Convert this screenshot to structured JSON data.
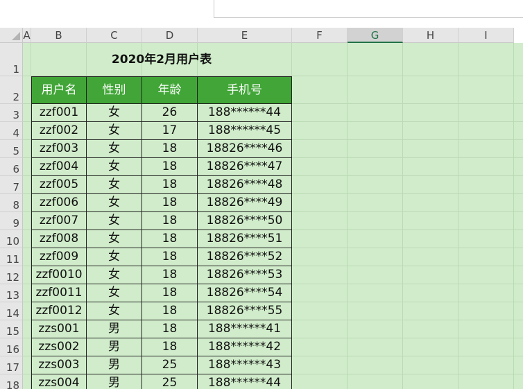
{
  "columns": [
    "A",
    "B",
    "C",
    "D",
    "E",
    "F",
    "G",
    "H",
    "I"
  ],
  "rows": [
    "1",
    "2",
    "3",
    "4",
    "5",
    "6",
    "7",
    "8",
    "9",
    "10",
    "11",
    "12",
    "13",
    "14",
    "15",
    "16",
    "17",
    "18"
  ],
  "sheet": {
    "title": "2020年2月用户表",
    "headers": [
      "用户名",
      "性别",
      "年龄",
      "手机号"
    ],
    "records": [
      [
        "zzf001",
        "女",
        "26",
        "188******44"
      ],
      [
        "zzf002",
        "女",
        "17",
        "188******45"
      ],
      [
        "zzf003",
        "女",
        "18",
        "18826****46"
      ],
      [
        "zzf004",
        "女",
        "18",
        "18826****47"
      ],
      [
        "zzf005",
        "女",
        "18",
        "18826****48"
      ],
      [
        "zzf006",
        "女",
        "18",
        "18826****49"
      ],
      [
        "zzf007",
        "女",
        "18",
        "18826****50"
      ],
      [
        "zzf008",
        "女",
        "18",
        "18826****51"
      ],
      [
        "zzf009",
        "女",
        "18",
        "18826****52"
      ],
      [
        "zzf0010",
        "女",
        "18",
        "18826****53"
      ],
      [
        "zzf0011",
        "女",
        "18",
        "18826****54"
      ],
      [
        "zzf0012",
        "女",
        "18",
        "18826****55"
      ],
      [
        "zzs001",
        "男",
        "18",
        "188******41"
      ],
      [
        "zzs002",
        "男",
        "18",
        "188******42"
      ],
      [
        "zzs003",
        "男",
        "25",
        "188******43"
      ],
      [
        "zzs004",
        "男",
        "25",
        "188******44"
      ]
    ]
  },
  "colors": {
    "header_fill": "#41a637",
    "sheet_fill": "#d0ecca",
    "selected_accent": "#217346"
  }
}
